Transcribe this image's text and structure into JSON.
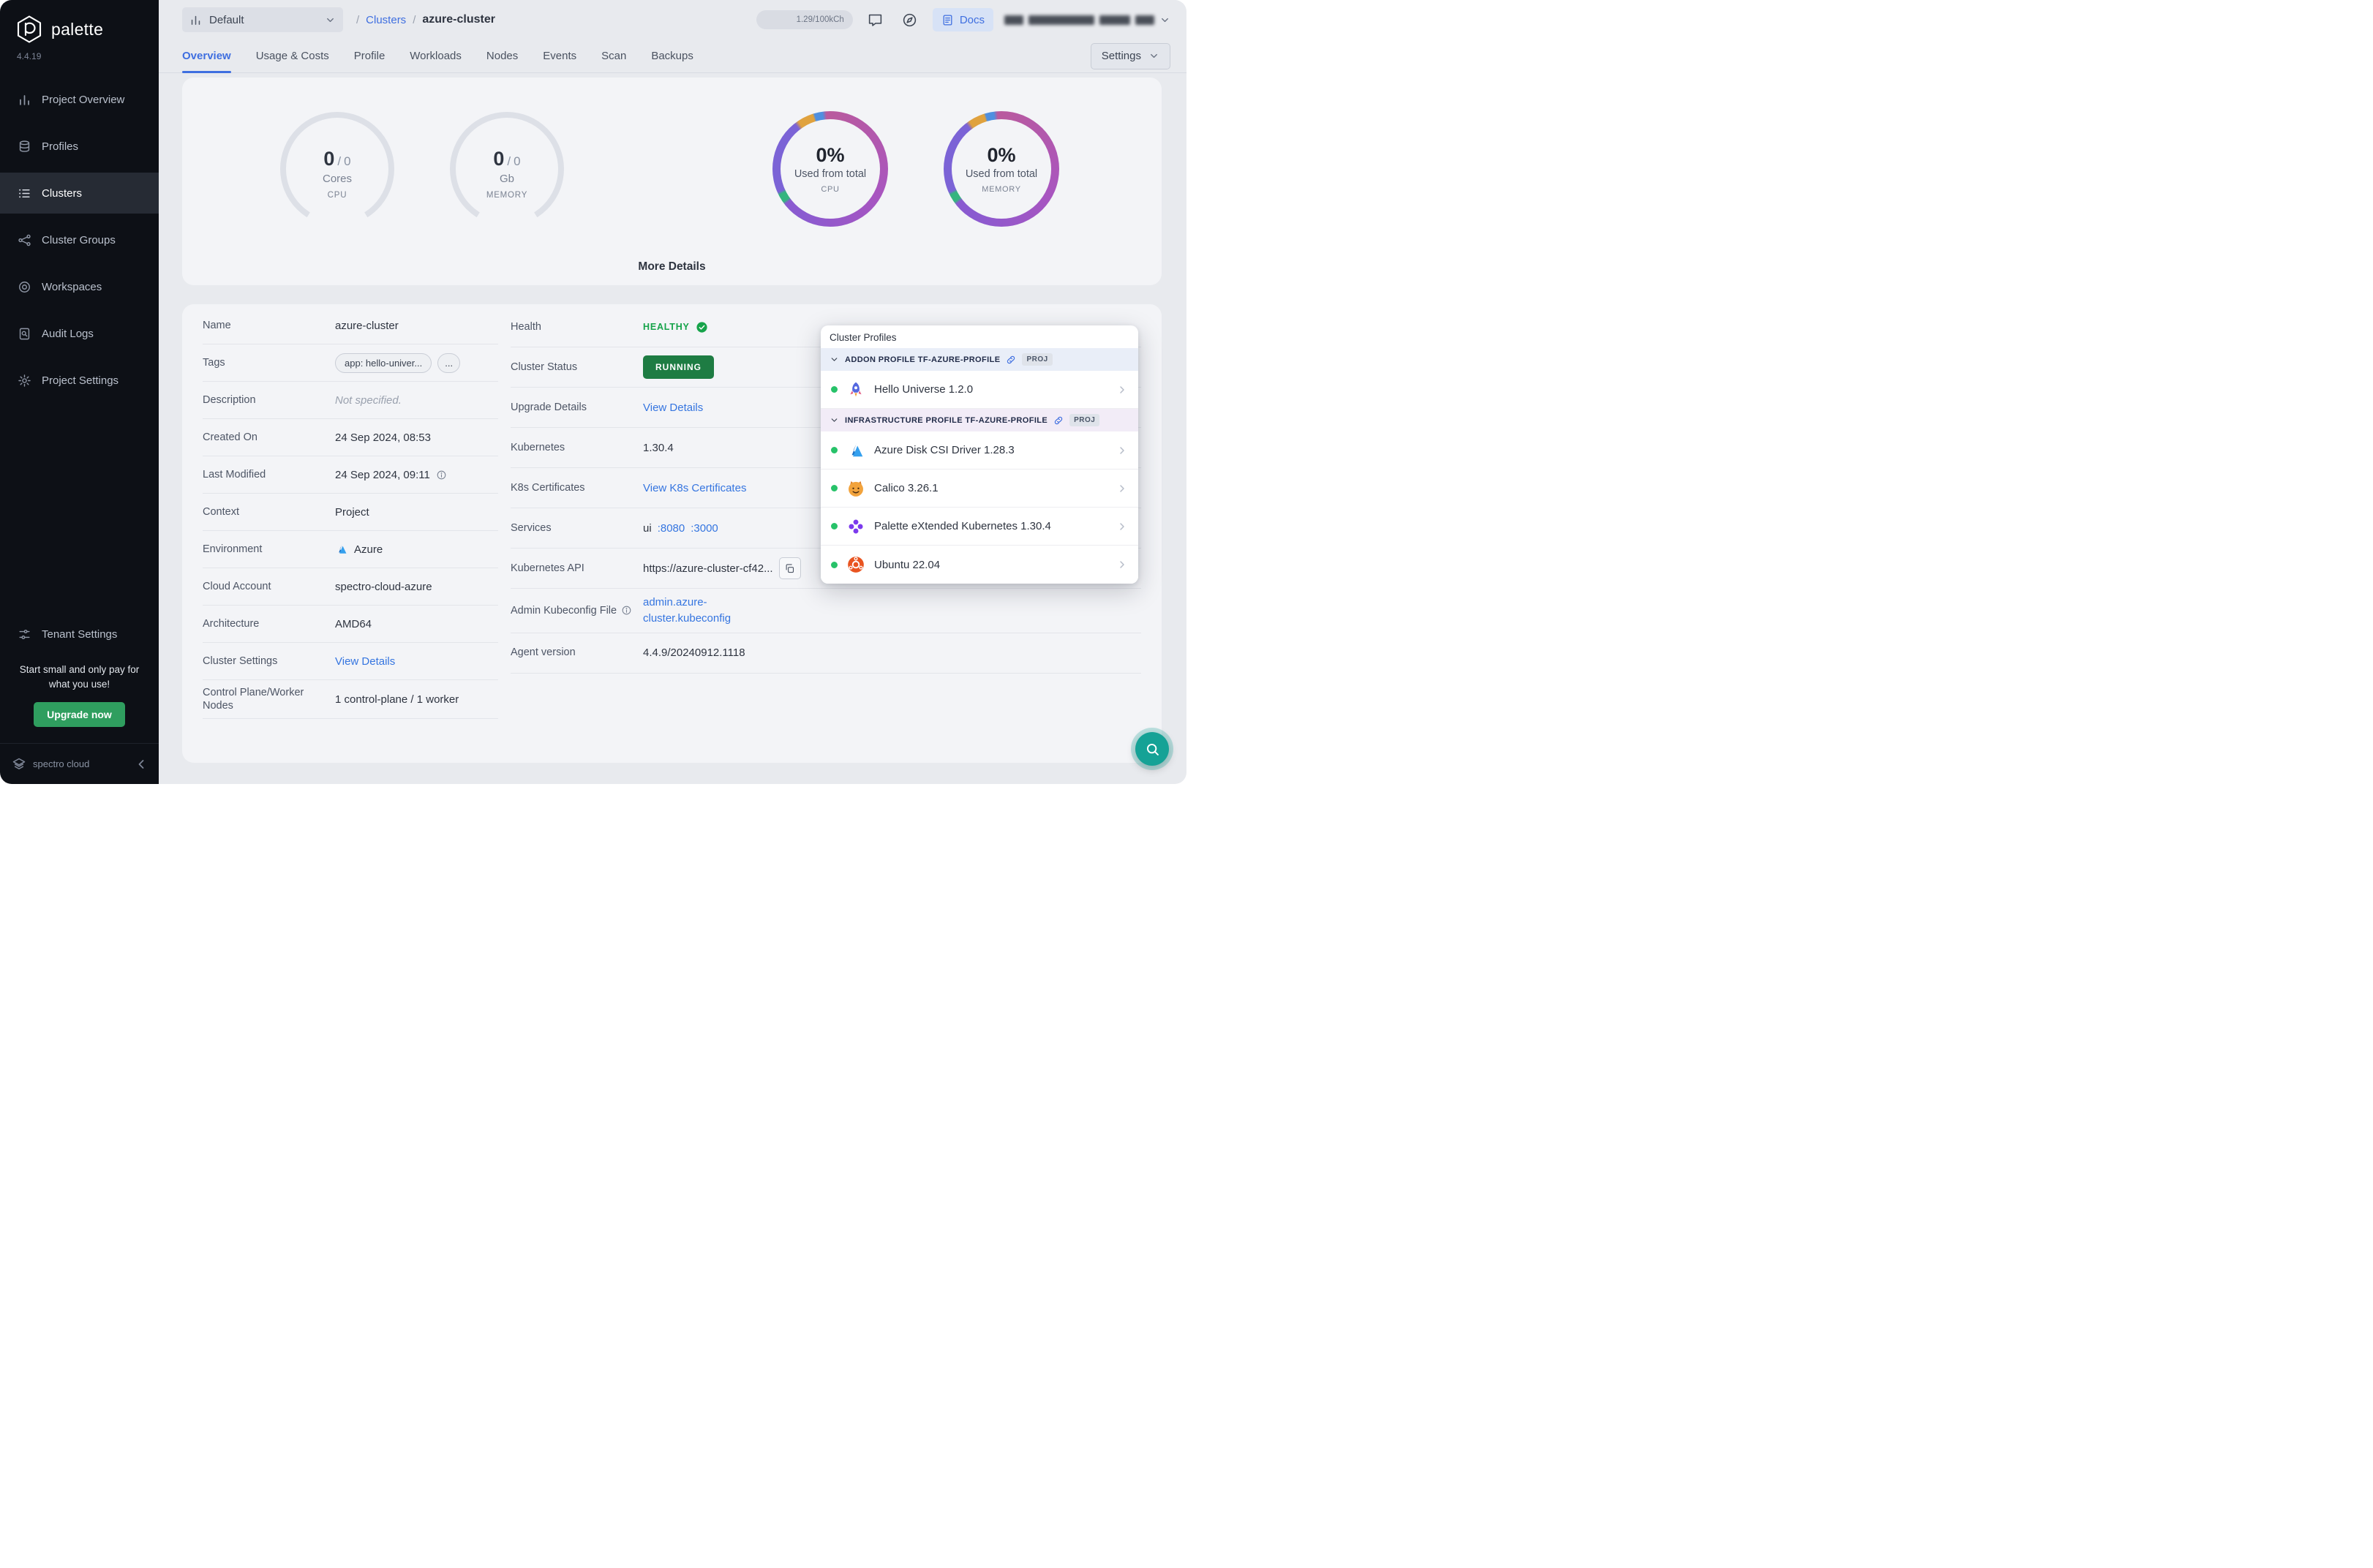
{
  "sidebar": {
    "brand": "palette",
    "version": "4.4.19",
    "items": [
      {
        "label": "Project Overview",
        "icon": "bar-chart",
        "active": false
      },
      {
        "label": "Profiles",
        "icon": "layers",
        "active": false
      },
      {
        "label": "Clusters",
        "icon": "list",
        "active": true
      },
      {
        "label": "Cluster Groups",
        "icon": "nodes",
        "active": false
      },
      {
        "label": "Workspaces",
        "icon": "target",
        "active": false
      },
      {
        "label": "Audit Logs",
        "icon": "doc-search",
        "active": false
      },
      {
        "label": "Project Settings",
        "icon": "gear",
        "active": false
      }
    ],
    "tenant_settings_label": "Tenant Settings",
    "promo_text": "Start small and only pay for what you use!",
    "upgrade_button": "Upgrade now",
    "footer_brand": "spectro cloud"
  },
  "header": {
    "project_selector": "Default",
    "breadcrumb": {
      "separator": "/",
      "section": "Clusters",
      "current": "azure-cluster"
    },
    "usage_pill": "1.29/100kCh",
    "docs_label": "Docs"
  },
  "tabs": {
    "items": [
      "Overview",
      "Usage & Costs",
      "Profile",
      "Workloads",
      "Nodes",
      "Events",
      "Scan",
      "Backups"
    ],
    "active": "Overview",
    "settings_button": "Settings"
  },
  "metrics": {
    "gauge_separator": "/",
    "gauges": [
      {
        "value": "0",
        "total": "0",
        "unit": "Cores",
        "caption": "CPU"
      },
      {
        "value": "0",
        "total": "0",
        "unit": "Gb",
        "caption": "MEMORY"
      }
    ],
    "donuts": [
      {
        "percent": "0%",
        "label": "Used from total",
        "caption": "CPU"
      },
      {
        "percent": "0%",
        "label": "Used from total",
        "caption": "MEMORY"
      }
    ],
    "more_details": "More Details"
  },
  "details": {
    "left": [
      {
        "label": "Name",
        "type": "text",
        "value": "azure-cluster"
      },
      {
        "label": "Tags",
        "type": "tags",
        "tags": [
          "app: hello-univer...",
          "..."
        ]
      },
      {
        "label": "Description",
        "type": "muted",
        "value": "Not specified."
      },
      {
        "label": "Created On",
        "type": "text",
        "value": "24 Sep 2024, 08:53"
      },
      {
        "label": "Last Modified",
        "type": "text-info",
        "value": "24 Sep 2024, 09:11"
      },
      {
        "label": "Context",
        "type": "text",
        "value": "Project"
      },
      {
        "label": "Environment",
        "type": "azure",
        "value": "Azure"
      },
      {
        "label": "Cloud Account",
        "type": "text",
        "value": "spectro-cloud-azure"
      },
      {
        "label": "Architecture",
        "type": "text",
        "value": "AMD64"
      },
      {
        "label": "Cluster Settings",
        "type": "link",
        "value": "View Details"
      },
      {
        "label": "Control Plane/Worker Nodes",
        "type": "text",
        "value": "1 control-plane / 1 worker"
      }
    ],
    "right": [
      {
        "label": "Health",
        "type": "health",
        "value": "HEALTHY"
      },
      {
        "label": "Cluster Status",
        "type": "status",
        "value": "RUNNING"
      },
      {
        "label": "Upgrade Details",
        "type": "link",
        "value": "View Details"
      },
      {
        "label": "Kubernetes",
        "type": "text",
        "value": "1.30.4"
      },
      {
        "label": "K8s Certificates",
        "type": "link",
        "value": "View K8s Certificates"
      },
      {
        "label": "Services",
        "type": "services",
        "parts": [
          {
            "text": "ui",
            "link": false
          },
          {
            "text": ":8080",
            "link": true
          },
          {
            "text": ":3000",
            "link": true
          }
        ]
      },
      {
        "label": "Kubernetes API",
        "type": "api",
        "value": "https://azure-cluster-cf42..."
      },
      {
        "label": "Admin Kubeconfig File",
        "label_info": true,
        "type": "kubeconfig",
        "value": "admin.azure-cluster.kubeconfig"
      },
      {
        "label": "Agent version",
        "type": "text",
        "value": "4.4.9/20240912.1118"
      }
    ]
  },
  "cluster_profiles": {
    "title": "Cluster Profiles",
    "sections": [
      {
        "kind": "addon",
        "name": "ADDON PROFILE TF-AZURE-PROFILE",
        "badge": "PROJ",
        "items": [
          {
            "name": "Hello Universe 1.2.0",
            "icon": "hello-universe"
          }
        ]
      },
      {
        "kind": "infra",
        "name": "INFRASTRUCTURE PROFILE TF-AZURE-PROFILE",
        "badge": "PROJ",
        "items": [
          {
            "name": "Azure Disk CSI Driver 1.28.3",
            "icon": "azure"
          },
          {
            "name": "Calico 3.26.1",
            "icon": "calico"
          },
          {
            "name": "Palette eXtended Kubernetes 1.30.4",
            "icon": "palette-pxk"
          },
          {
            "name": "Ubuntu 22.04",
            "icon": "ubuntu"
          }
        ]
      }
    ]
  },
  "colors": {
    "accent_blue": "#3f6fe0",
    "link_blue": "#3575e0",
    "healthy_green": "#16a34a",
    "running_green": "#1e7c43",
    "upgrade_green": "#2f9e5f",
    "status_dot_green": "#27c269",
    "fab_teal": "#15a296",
    "donut_ring": [
      "#b95a9e",
      "#a855c0",
      "#8a5ad0",
      "#7b63d6",
      "#35b57f",
      "#e0a23e",
      "#4f8fe0"
    ]
  }
}
